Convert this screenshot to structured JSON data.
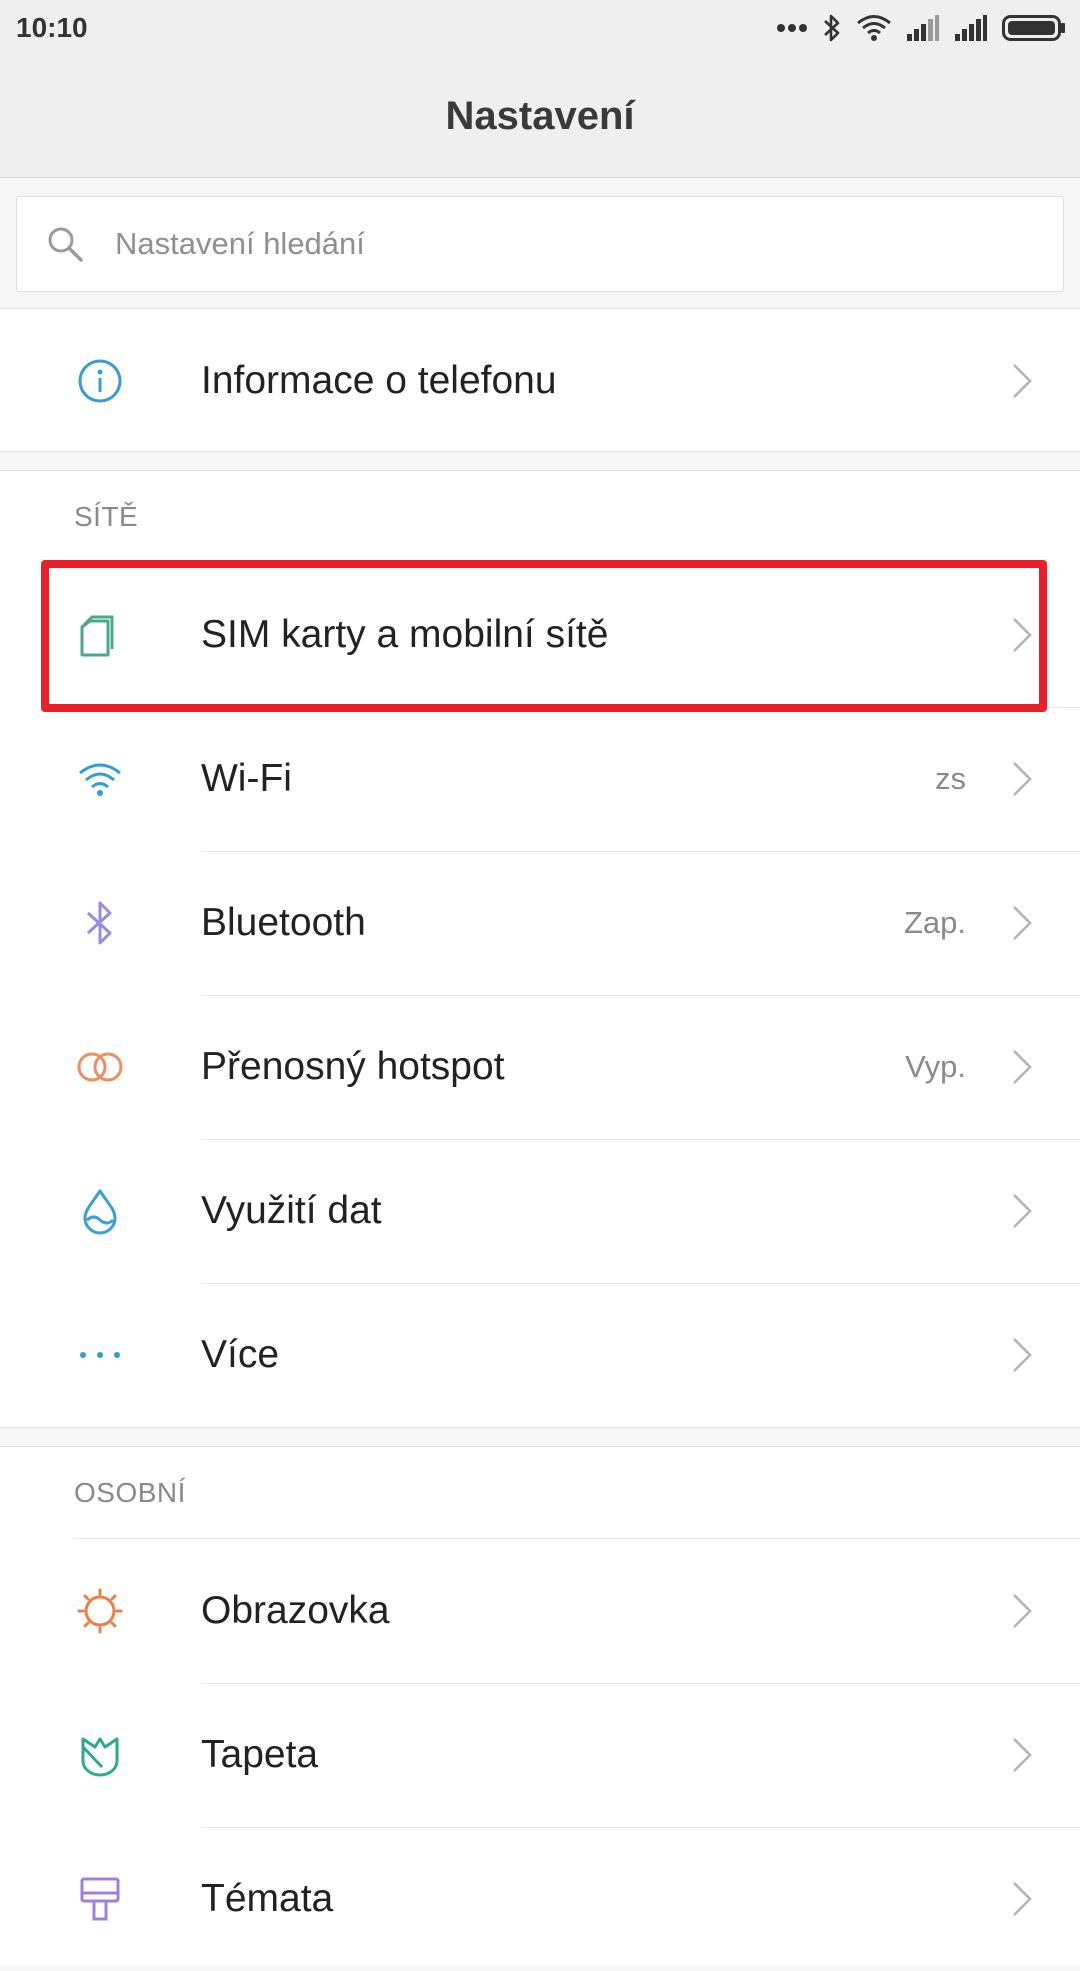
{
  "status": {
    "time": "10:10",
    "icons": [
      "more-dots-icon",
      "bluetooth-icon",
      "wifi-icon",
      "signal-icon",
      "signal-icon",
      "battery-icon"
    ]
  },
  "header": {
    "title": "Nastavení"
  },
  "search": {
    "placeholder": "Nastavení hledání"
  },
  "top_item": {
    "label": "Informace o telefonu",
    "icon": "info-icon"
  },
  "networks": {
    "header": "SÍTĚ",
    "items": [
      {
        "label": "SIM karty a mobilní sítě",
        "value": "",
        "icon": "sim-icon"
      },
      {
        "label": "Wi-Fi",
        "value": "zs",
        "icon": "wifi-icon"
      },
      {
        "label": "Bluetooth",
        "value": "Zap.",
        "icon": "bluetooth-icon"
      },
      {
        "label": "Přenosný hotspot",
        "value": "Vyp.",
        "icon": "hotspot-icon"
      },
      {
        "label": "Využití dat",
        "value": "",
        "icon": "data-usage-icon"
      },
      {
        "label": "Více",
        "value": "",
        "icon": "more-icon"
      }
    ]
  },
  "personal": {
    "header": "OSOBNÍ",
    "items": [
      {
        "label": "Obrazovka",
        "icon": "display-icon"
      },
      {
        "label": "Tapeta",
        "icon": "wallpaper-icon"
      },
      {
        "label": "Témata",
        "icon": "themes-icon"
      }
    ]
  },
  "colors": {
    "highlight": "#e8202a",
    "info": "#3a9bd0",
    "sim": "#4aa886",
    "wifi": "#2f9fd8",
    "bluetooth": "#9b8be0",
    "hotspot": "#e89064",
    "data": "#3aa0d0",
    "more": "#2f9fd8",
    "display": "#e8804a",
    "wallpaper": "#2ea88a",
    "themes": "#a080d8"
  }
}
